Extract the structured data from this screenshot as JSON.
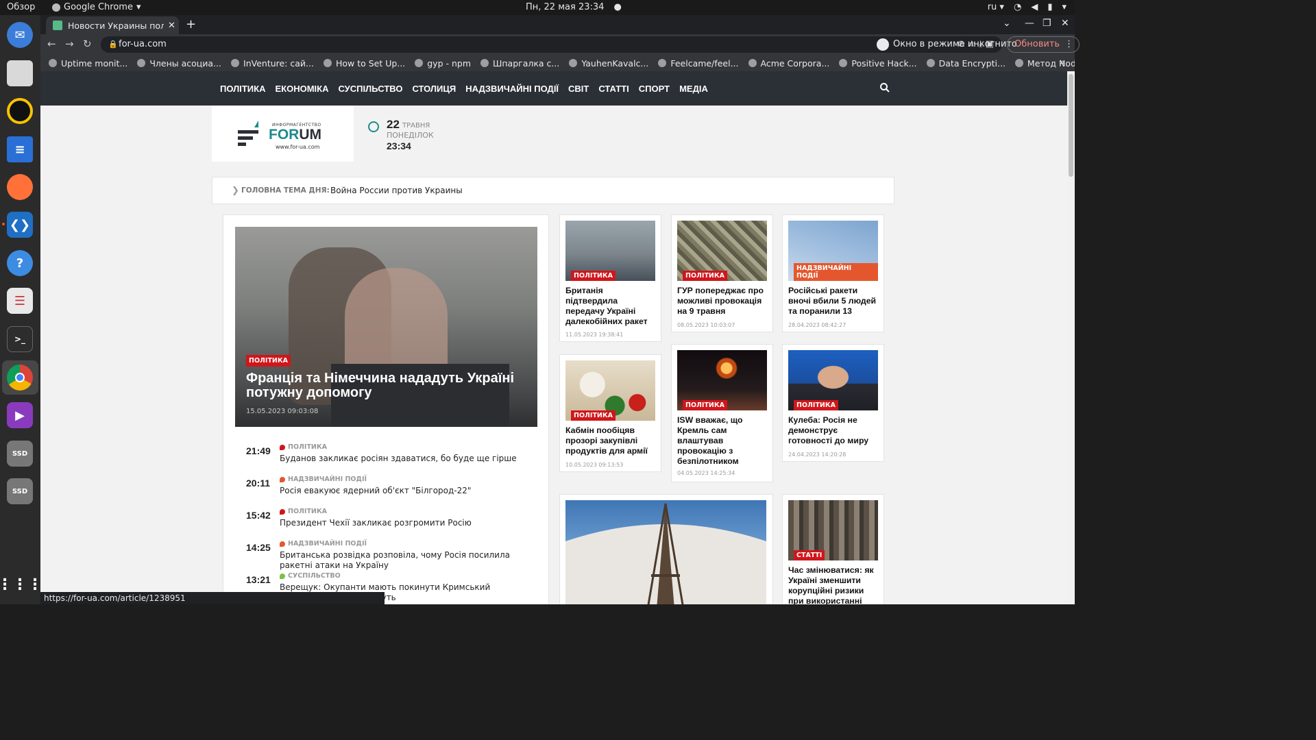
{
  "topbar": {
    "overview": "Обзор",
    "app_name": "Google Chrome",
    "datetime": "Пн, 22 мая  23:34",
    "bullet": "●",
    "lang": "ru"
  },
  "browser": {
    "tab_title": "Новости Украины полит",
    "tab_close": "✕",
    "newtab": "+",
    "url": "for-ua.com",
    "incognito_label": "Окно в режиме инкогнито",
    "update_label": "Обновить",
    "bookmarks": [
      "Uptime monit...",
      "Члены асоциа...",
      "InVenture: сай...",
      "How to Set Up...",
      "gyp - npm",
      "Шпаргалка с...",
      "YauhenKavalc...",
      "Feelcame/feel...",
      "Acme Corpora...",
      "Positive Hack...",
      "Data Encrypti...",
      "Метод Node.j..."
    ],
    "bookmarks_more": "»",
    "status_url": "https://for-ua.com/article/1238951"
  },
  "site": {
    "nav": [
      "ПОЛІТИКА",
      "ЕКОНОМІКА",
      "СУСПІЛЬСТВО",
      "СТОЛИЦЯ",
      "НАДЗВИЧАЙНІ ПОДІЇ",
      "СВІТ",
      "СТАТТІ",
      "СПОРТ",
      "МЕДІА"
    ],
    "logo": {
      "agency": "ИНФОРМАГЕНТСТВО",
      "brand_for": "FOR",
      "brand_um": "UM",
      "site": "www.for-ua.com"
    },
    "date": {
      "day": "22",
      "month": "ТРАВНЯ",
      "weekday": "ПОНЕДІЛОК",
      "time": "23:34"
    },
    "topic_label": "ГОЛОВНА ТЕМА ДНЯ:",
    "topic": "Война России против Украины",
    "hero": {
      "category": "ПОЛІТИКА",
      "headline": "Франція та Німеччина нададуть Україні потужну допомогу",
      "date": "15.05.2023 09:03:08"
    },
    "feed": [
      {
        "time": "21:49",
        "category": "ПОЛІТИКА",
        "color": "#d0161b",
        "text": "Буданов закликає росіян здаватися, бо буде ще гірше"
      },
      {
        "time": "20:11",
        "category": "НАДЗВИЧАЙНІ ПОДІЇ",
        "color": "#e4572e",
        "text": "Росія евакуює ядерний об'єкт \"Білгород-22\""
      },
      {
        "time": "15:42",
        "category": "ПОЛІТИКА",
        "color": "#d0161b",
        "text": "Президент Чехії закликає розгромити Росію"
      },
      {
        "time": "14:25",
        "category": "НАДЗВИЧАЙНІ ПОДІЇ",
        "color": "#e4572e",
        "text": "Британська розвідка розповіла, чому Росія посилила ракетні атаки на Україну"
      },
      {
        "time": "13:21",
        "category": "СУСПІЛЬСТВО",
        "color": "#7cc242",
        "text": "Верещук: Окупанти мають покинути Кримський півострів, поки ще можуть"
      }
    ],
    "cards": [
      {
        "category": "ПОЛІТИКА",
        "title": "Британія підтвердила передачу Україні далекобійних ракет",
        "date": "11.05.2023 19:38:41"
      },
      {
        "category": "ПОЛІТИКА",
        "title": "ГУР попереджає про можливі провокація на 9 травня",
        "date": "08.05.2023 10:03:07"
      },
      {
        "category": "НАДЗВИЧАЙНІ ПОДІЇ",
        "title": "Російські ракети вночі вбили 5 людей та поранили 13",
        "date": "28.04.2023 08:42:27"
      },
      {
        "category": "ПОЛІТИКА",
        "title": "Кабмін пообіцяв прозорі закупівлі продуктів для армії",
        "date": "10.05.2023 09:13:53"
      },
      {
        "category": "ПОЛІТИКА",
        "title": "ISW вважає, що Кремль сам влаштував провокацію з безпілотником",
        "date": "04.05.2023 14:25:34"
      },
      {
        "category": "ПОЛІТИКА",
        "title": "Кулеба: Росія не демонструє готовності до миру",
        "date": "24.04.2023 14:20:28"
      },
      {
        "category": "СТАТТІ",
        "title": "Час змінюватися: як Україні зменшити корупційні ризики при використанні коштів на відновлення",
        "date": ""
      }
    ]
  }
}
